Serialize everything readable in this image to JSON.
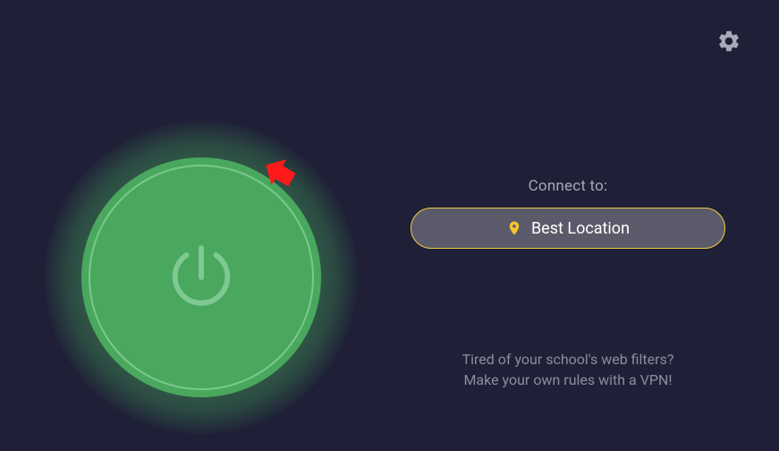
{
  "header": {
    "settings_icon": "settings"
  },
  "power": {
    "icon": "power",
    "state": "on"
  },
  "annotation": {
    "arrow": "red-arrow"
  },
  "connect": {
    "label": "Connect to:",
    "location_icon": "location-pin",
    "location_text": "Best Location"
  },
  "promo": {
    "line1": "Tired of your school's web filters?",
    "line2": "Make your own rules with a VPN!"
  },
  "colors": {
    "background": "#1f2037",
    "power_green": "#4aa85e",
    "accent_yellow": "#e8c843",
    "annotation_red": "#ff1a1a"
  }
}
